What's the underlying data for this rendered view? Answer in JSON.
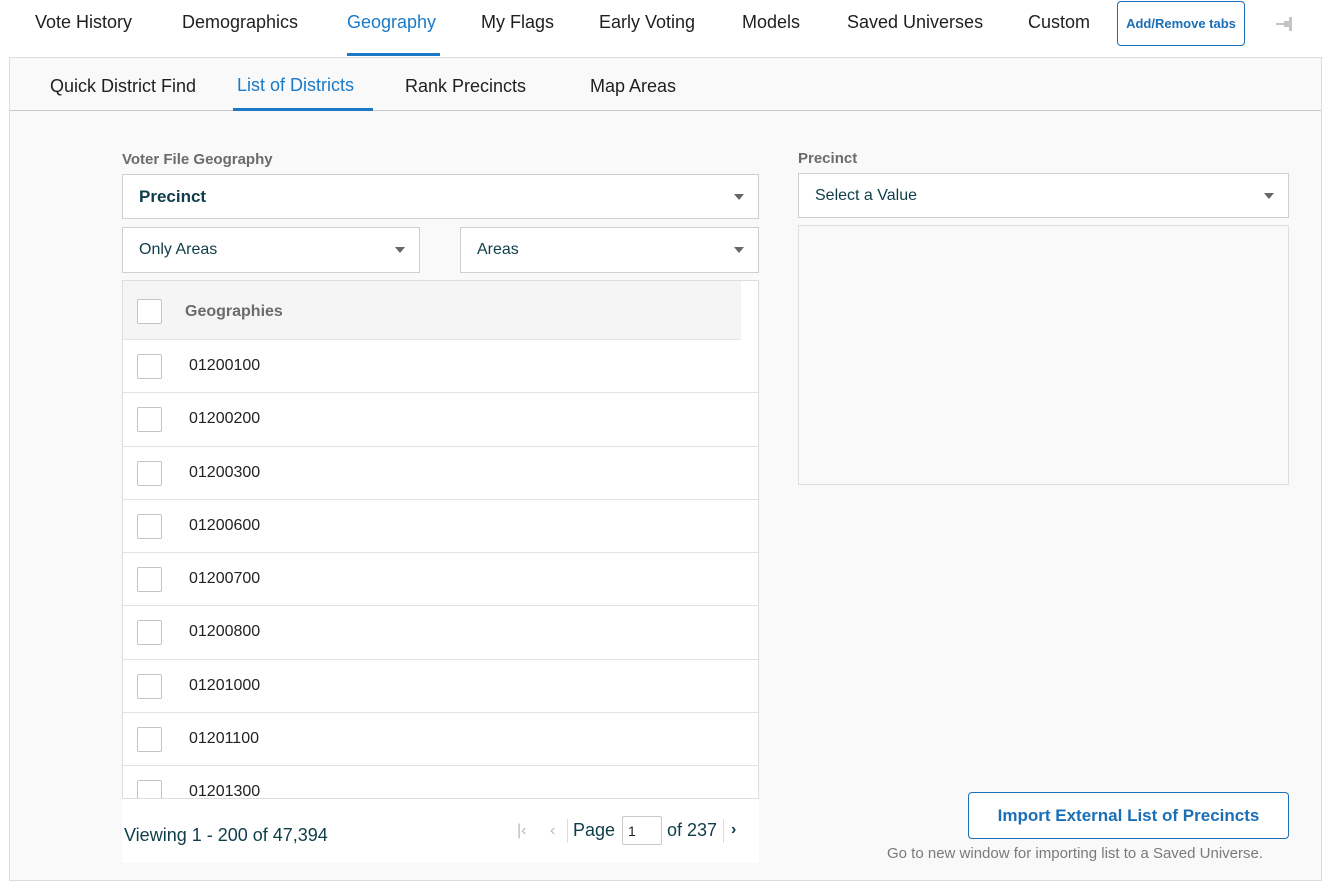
{
  "top_tabs": [
    "Vote History",
    "Demographics",
    "Geography",
    "My Flags",
    "Early Voting",
    "Models",
    "Saved Universes",
    "Custom"
  ],
  "active_top_tab": "Geography",
  "add_tabs_label": "Add/Remove tabs",
  "pin_icon": "pin-icon",
  "sub_tabs": [
    "Quick District Find",
    "List of Districts",
    "Rank Precincts",
    "Map Areas"
  ],
  "active_sub_tab": "List of Districts",
  "voter_file_geography": {
    "label": "Voter File Geography",
    "selected": "Precinct"
  },
  "filter_select": {
    "selected": "Only Areas"
  },
  "type_select": {
    "selected": "Areas"
  },
  "grid": {
    "header": "Geographies",
    "rows": [
      "01200100",
      "01200200",
      "01200300",
      "01200600",
      "01200700",
      "01200800",
      "01201000",
      "01201100",
      "01201300"
    ]
  },
  "pager": {
    "viewing": "Viewing 1 - 200 of 47,394",
    "page_label": "Page",
    "page_value": "1",
    "of_label": "of 237"
  },
  "precinct": {
    "label": "Precinct",
    "placeholder": "Select a Value"
  },
  "import_button": "Import External List of Precincts",
  "import_hint": "Go to new window for importing list to a Saved Universe.",
  "colors": {
    "accent": "#1a7ac7",
    "button_border": "#1a6fb6",
    "text_dark": "#0f3d4a"
  }
}
